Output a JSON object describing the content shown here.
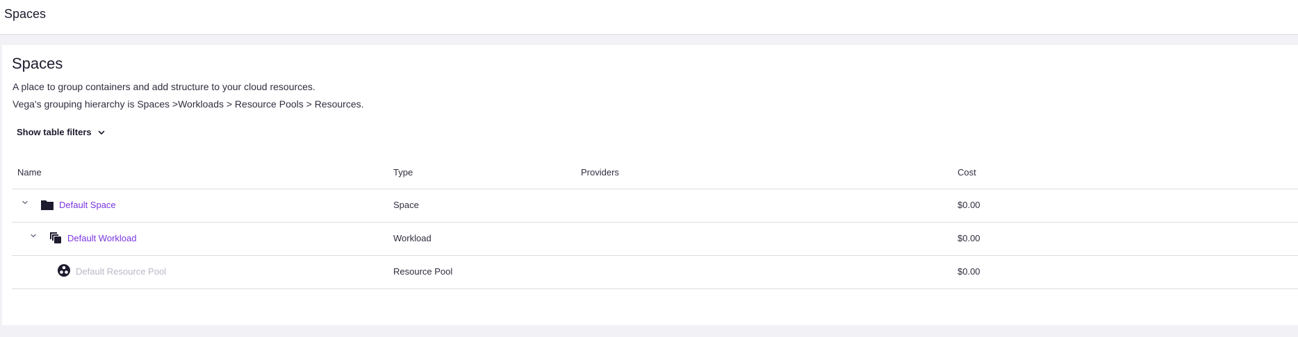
{
  "topbar": {
    "title": "Spaces"
  },
  "page": {
    "title": "Spaces",
    "description_line1": "A place to group containers and add structure to your cloud resources.",
    "description_line2": "Vega's grouping hierarchy is Spaces >Workloads > Resource Pools > Resources."
  },
  "filters": {
    "toggle_label": "Show table filters",
    "icon": "chevron-down-icon"
  },
  "table": {
    "columns": [
      "Name",
      "Type",
      "Providers",
      "Cost"
    ],
    "rows": [
      {
        "name": "Default Space",
        "type": "Space",
        "providers": "",
        "cost": "$0.00",
        "icon": "folder-icon",
        "expandable": true,
        "link": true
      },
      {
        "name": "Default Workload",
        "type": "Workload",
        "providers": "",
        "cost": "$0.00",
        "icon": "stacked-squares-icon",
        "expandable": true,
        "link": true
      },
      {
        "name": "Default Resource Pool",
        "type": "Resource Pool",
        "providers": "",
        "cost": "$0.00",
        "icon": "resource-pool-icon",
        "expandable": false,
        "link": false
      }
    ]
  },
  "colors": {
    "link": "#7b35e0",
    "disabled_text": "#b9b8c6",
    "background": "#f1f1f6",
    "icon": "#1d1b2e"
  }
}
